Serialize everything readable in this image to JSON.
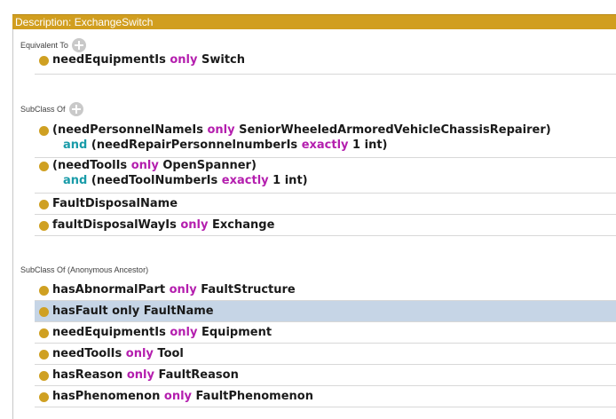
{
  "title": "Description: ExchangeSwitch",
  "sections": {
    "equivalent": {
      "header": "Equivalent To",
      "rows": [
        {
          "line1": {
            "a": "needEquipmentIs",
            "kw": "only",
            "b": "Switch"
          }
        }
      ]
    },
    "subclass": {
      "header": "SubClass Of",
      "rows": [
        {
          "line1": {
            "a": "(needPersonnelNameIs",
            "kw": "only",
            "b": "SeniorWheeledArmoredVehicleChassisRepairer)"
          },
          "line2": {
            "and": "and",
            "a": "(needRepairPersonnelnumberIs",
            "kw": "exactly",
            "b": "1 int)"
          }
        },
        {
          "line1": {
            "a": "(needToolIs",
            "kw": "only",
            "b": "OpenSpanner)"
          },
          "line2": {
            "and": "and",
            "a": "(needToolNumberIs",
            "kw": "exactly",
            "b": "1 int)"
          }
        },
        {
          "line1": {
            "a": "FaultDisposalName"
          }
        },
        {
          "line1": {
            "a": "faultDisposalWayIs",
            "kw": "only",
            "b": "Exchange"
          }
        }
      ]
    },
    "ancestor": {
      "header": "SubClass Of (Anonymous Ancestor)",
      "rows": [
        {
          "line1": {
            "a": "hasAbnormalPart",
            "kw": "only",
            "b": "FaultStructure"
          }
        },
        {
          "line1": {
            "a": "hasFault only FaultName"
          }
        },
        {
          "line1": {
            "a": "needEquipmentIs",
            "kw": "only",
            "b": "Equipment"
          }
        },
        {
          "line1": {
            "a": "needToolIs",
            "kw": "only",
            "b": "Tool"
          }
        },
        {
          "line1": {
            "a": "hasReason",
            "kw": "only",
            "b": "FaultReason"
          }
        },
        {
          "line1": {
            "a": "hasPhenomenon",
            "kw": "only",
            "b": "FaultPhenomenon"
          }
        }
      ]
    }
  },
  "colors": {
    "title_bar": "#d19e1f",
    "keyword_quantifier": "#b41eae",
    "keyword_and": "#1a9ca9",
    "bullet": "#cfa022",
    "selected_row": "#c6d5e6"
  },
  "icons": {
    "add": "plus-circle-icon",
    "bullet": "class-bullet-icon"
  },
  "selected": "hasFault only FaultName"
}
